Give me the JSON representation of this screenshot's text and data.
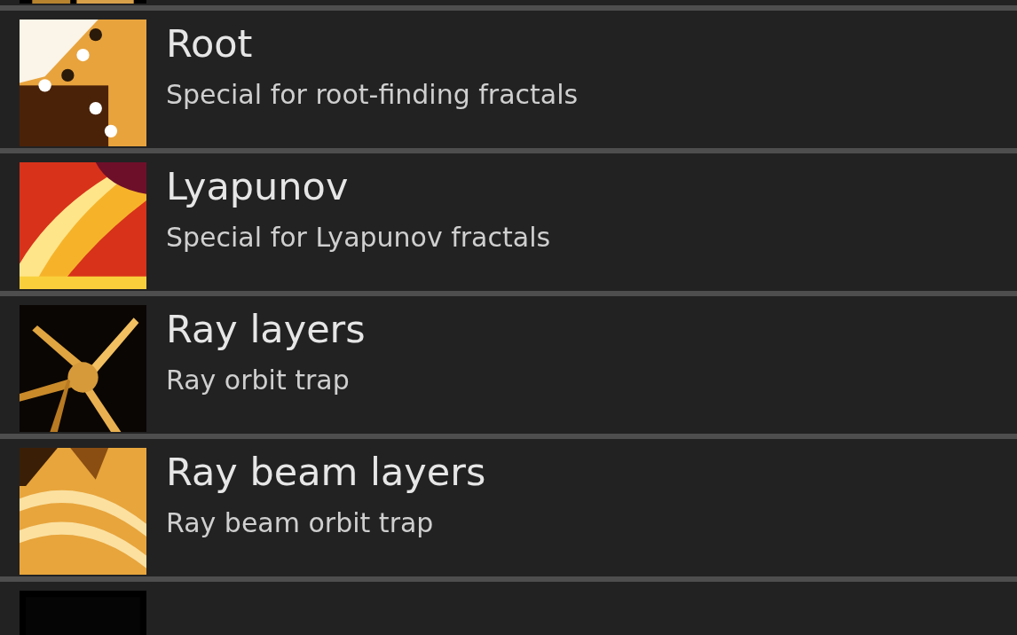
{
  "items": [
    {
      "kind": "cut"
    },
    {
      "kind": "entry",
      "title": "Root",
      "subtitle": "Special for root-finding fractals"
    },
    {
      "kind": "entry",
      "title": "Lyapunov",
      "subtitle": "Special for Lyapunov fractals"
    },
    {
      "kind": "entry",
      "title": "Ray layers",
      "subtitle": "Ray orbit trap"
    },
    {
      "kind": "entry",
      "title": "Ray beam layers",
      "subtitle": "Ray beam orbit trap"
    },
    {
      "kind": "cut"
    }
  ]
}
